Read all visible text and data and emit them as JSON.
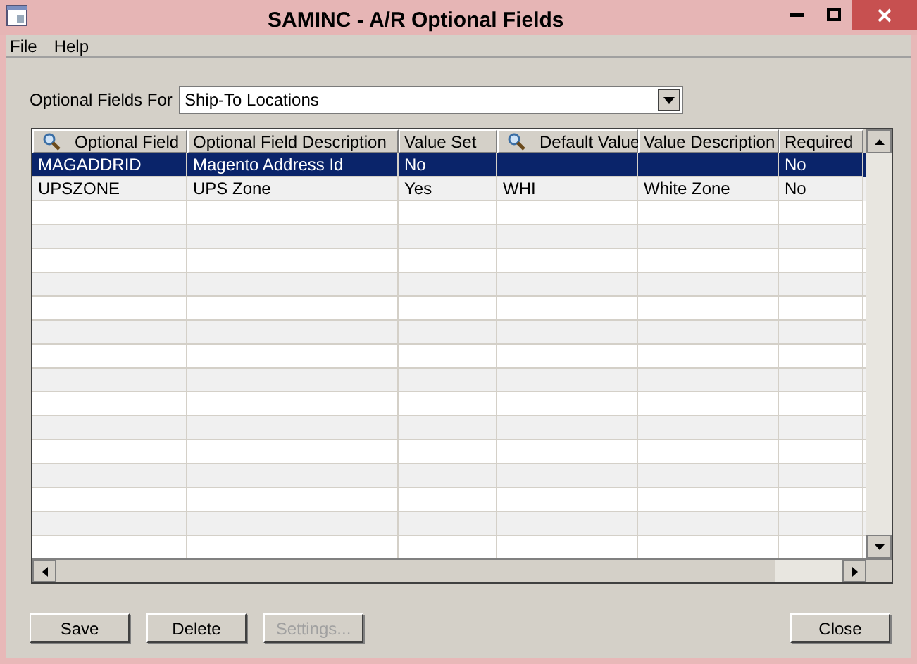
{
  "window": {
    "title": "SAMINC - A/R Optional Fields"
  },
  "menu": [
    {
      "label": "File"
    },
    {
      "label": "Help"
    }
  ],
  "optional_fields_for": {
    "label": "Optional Fields For",
    "value": "Ship-To Locations"
  },
  "table": {
    "columns": [
      {
        "label": "Optional Field",
        "finder": true
      },
      {
        "label": "Optional Field Description",
        "finder": false
      },
      {
        "label": "Value Set",
        "finder": false
      },
      {
        "label": "Default Value",
        "finder": true
      },
      {
        "label": "Value Description",
        "finder": false
      },
      {
        "label": "Required",
        "finder": false
      }
    ],
    "rows": [
      {
        "selected": true,
        "cells": [
          "MAGADDRID",
          "Magento Address Id",
          "No",
          "",
          "",
          "No"
        ]
      },
      {
        "selected": false,
        "cells": [
          "UPSZONE",
          "UPS Zone",
          "Yes",
          "WHI",
          "White Zone",
          "No"
        ]
      }
    ]
  },
  "buttons": [
    {
      "label": "Save",
      "disabled": false
    },
    {
      "label": "Delete",
      "disabled": false
    },
    {
      "label": "Settings...",
      "disabled": true
    },
    {
      "label": "Close",
      "disabled": false
    }
  ]
}
